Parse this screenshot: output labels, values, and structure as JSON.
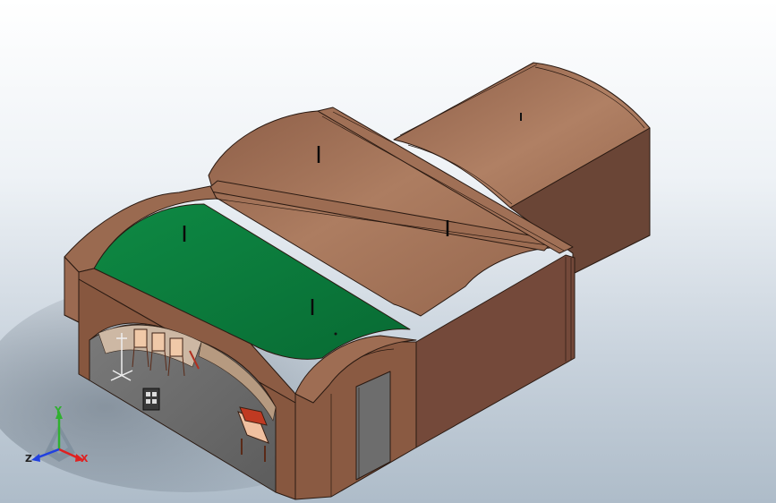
{
  "viewport": {
    "background_top": "#ffffff",
    "background_bottom": "#aebcc9"
  },
  "model": {
    "colors": {
      "wall_front": "#8a5a43",
      "wall_side": "#6e4839",
      "roof_light": "#a8775c",
      "roof_mid": "#97684f",
      "roof_green": "#0b7a3b",
      "interior_floor": "#6b6b6b",
      "interior_wall": "#d9cfc4",
      "door": "#6d6d6d",
      "edge": "#2a1a12"
    }
  },
  "triad": {
    "x_label": "X",
    "y_label": "Y",
    "z_label": "Z",
    "x_color": "#e02020",
    "y_color": "#30b030",
    "z_color": "#2040e0"
  }
}
